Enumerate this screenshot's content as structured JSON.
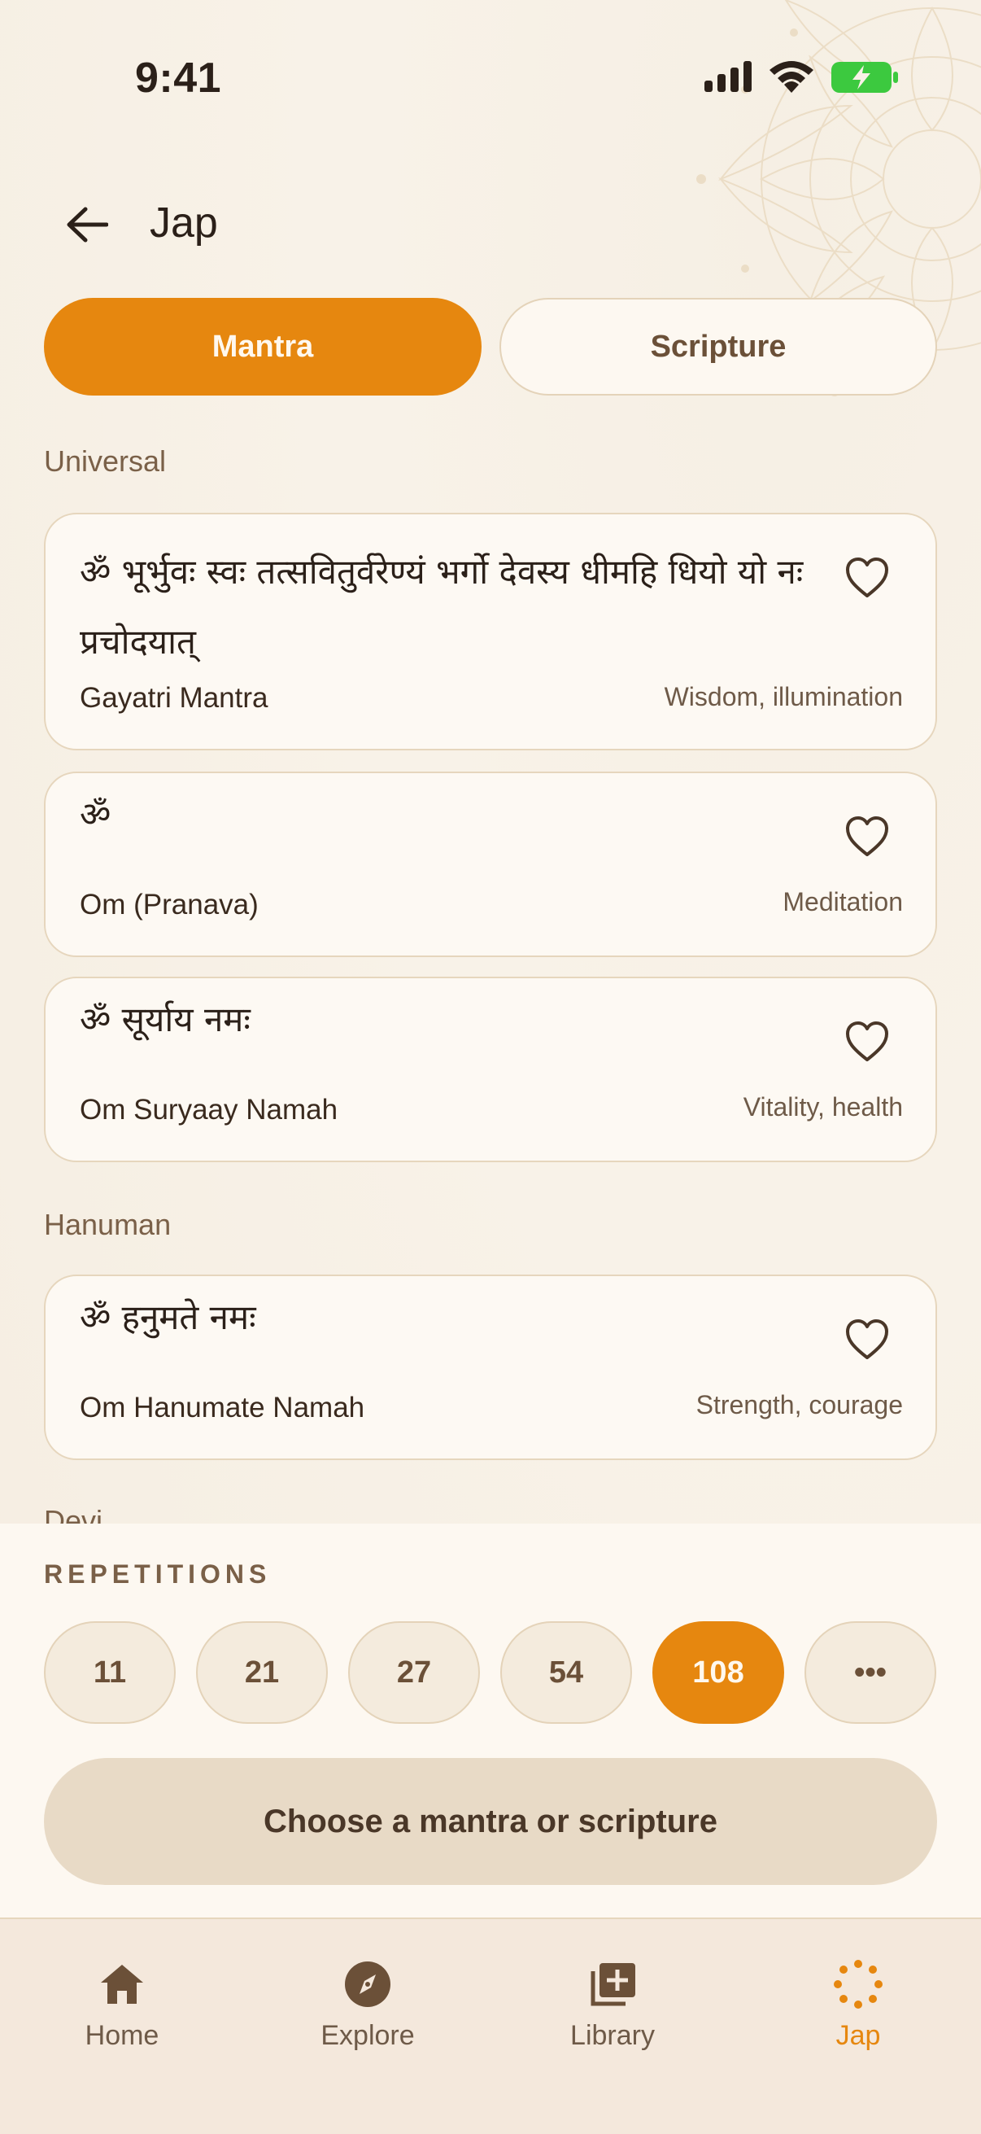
{
  "status_bar": {
    "time": "9:41"
  },
  "header": {
    "title": "Jap"
  },
  "tabs": [
    {
      "label": "Mantra",
      "active": true
    },
    {
      "label": "Scripture",
      "active": false
    }
  ],
  "sections": [
    {
      "label": "Universal",
      "items": [
        {
          "sanskrit": "ॐ भूर्भुवः स्वः तत्सवितुर्वरेण्यं भर्गो देवस्य धीमहि धियो यो नः प्रचोदयात्",
          "name": "Gayatri Mantra",
          "benefit": "Wisdom, illumination"
        },
        {
          "sanskrit": "ॐ",
          "name": "Om (Pranava)",
          "benefit": "Meditation"
        },
        {
          "sanskrit": "ॐ सूर्याय नमः",
          "name": "Om Suryaay Namah",
          "benefit": "Vitality, health"
        }
      ]
    },
    {
      "label": "Hanuman",
      "items": [
        {
          "sanskrit": "ॐ हनुमते नमः",
          "name": "Om Hanumate Namah",
          "benefit": "Strength, courage"
        }
      ]
    },
    {
      "label": "Devi",
      "items": []
    }
  ],
  "repetitions": {
    "label": "REPETITIONS",
    "options": [
      "11",
      "21",
      "27",
      "54",
      "108",
      "•••"
    ],
    "selected": "108"
  },
  "cta": {
    "label": "Choose a mantra or scripture"
  },
  "nav": {
    "items": [
      {
        "label": "Home",
        "icon": "home-icon"
      },
      {
        "label": "Explore",
        "icon": "compass-icon"
      },
      {
        "label": "Library",
        "icon": "library-add-icon"
      },
      {
        "label": "Jap",
        "icon": "jap-beads-icon",
        "active": true
      }
    ]
  },
  "colors": {
    "accent": "#e6870f",
    "background": "#f8f1e7",
    "card": "#fdf9f3",
    "border": "#e6d6bd"
  }
}
